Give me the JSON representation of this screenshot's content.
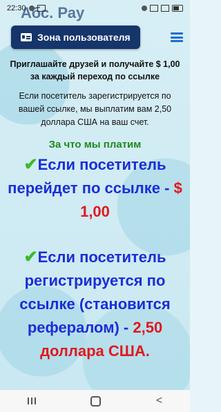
{
  "status": {
    "time": "22:30",
    "battery": ""
  },
  "logo_partial": "Абс. Рау",
  "header": {
    "zone_label": "Зона пользователя"
  },
  "content": {
    "promo": "Приглашайте друзей и получайте $ 1,00 за каждый переход по ссылке",
    "register_note": "Если посетитель зарегистрируется по вашей ссылке, мы выплатим вам 2,50 доллара США на ваш счет.",
    "why_title": "За что мы платим",
    "item1_text": "Если посетитель перейдет по ссылке -",
    "item1_amount": "$ 1,00",
    "item2_text": "Если посетитель регистрируется по ссылке (становится рефералом) -",
    "item2_amount": "2,50 доллара США."
  },
  "icons": {
    "zone": "id-card-icon",
    "menu": "hamburger-menu-icon",
    "check": "green-check-icon"
  }
}
